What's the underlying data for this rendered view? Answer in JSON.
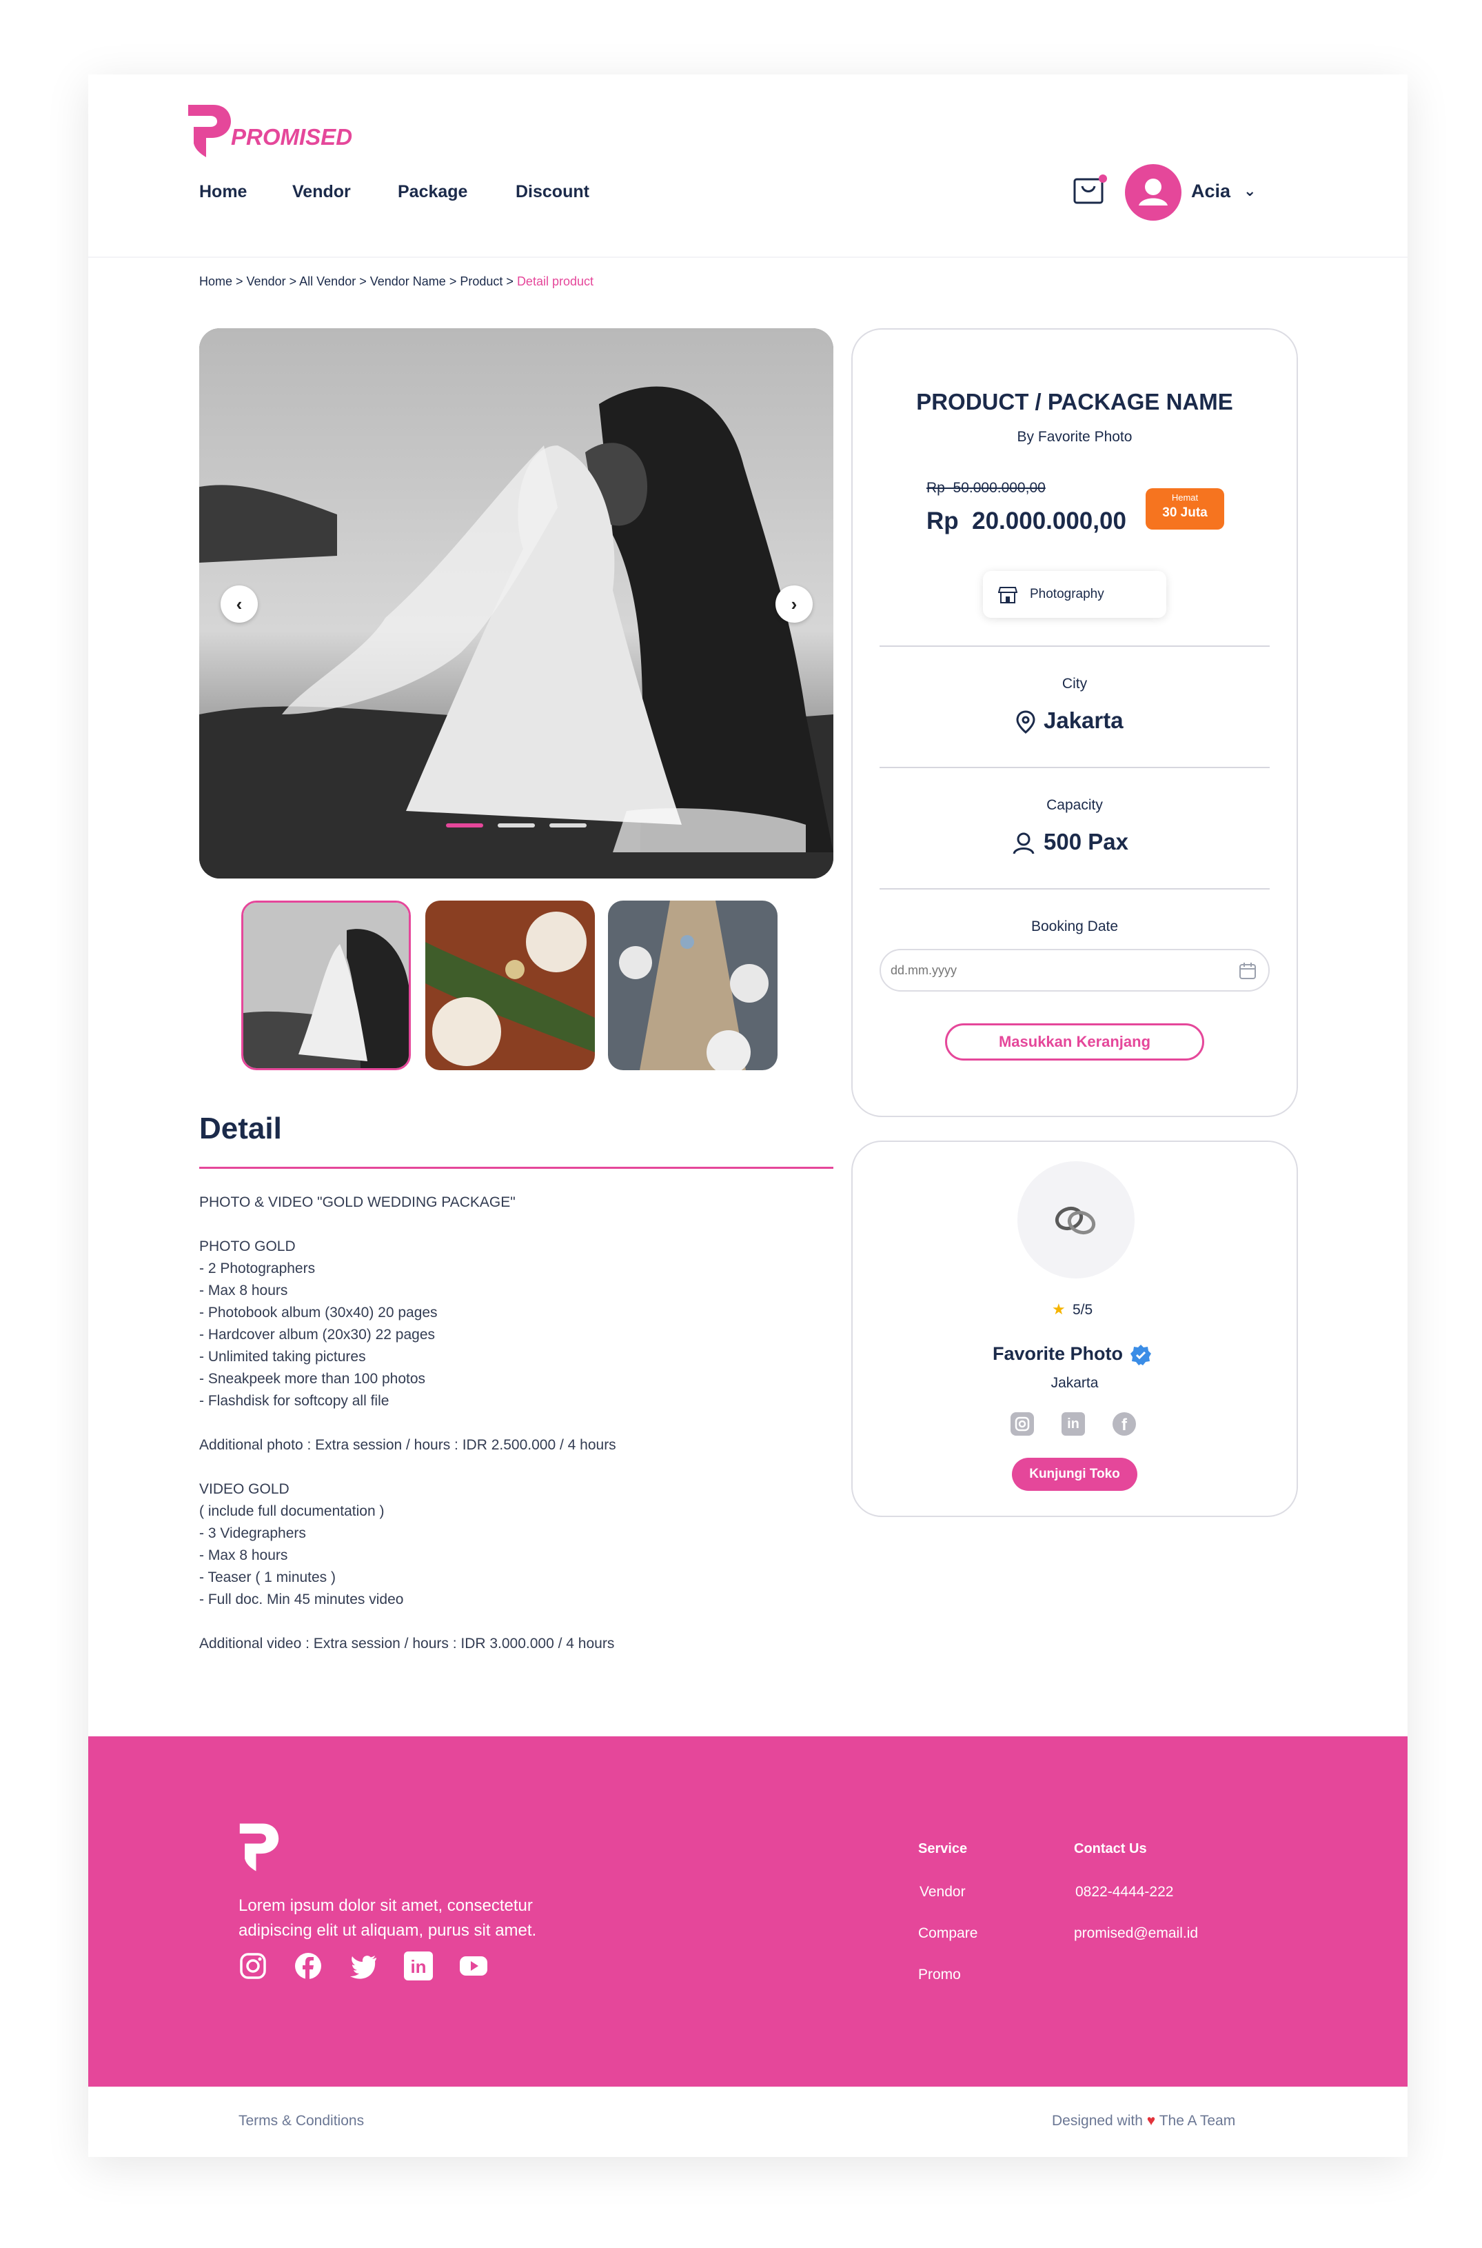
{
  "brand": {
    "name": "PROMISED",
    "accent": "#e5479a",
    "dark": "#1b2a4a"
  },
  "nav": {
    "items": [
      {
        "label": "Home"
      },
      {
        "label": "Vendor"
      },
      {
        "label": "Package"
      },
      {
        "label": "Discount"
      }
    ]
  },
  "user": {
    "name": "Acia"
  },
  "breadcrumb": {
    "items": [
      {
        "label": "Home"
      },
      {
        "label": "Vendor"
      },
      {
        "label": "All Vendor"
      },
      {
        "label": "Vendor Name"
      },
      {
        "label": "Product"
      }
    ],
    "current": "Detail product"
  },
  "gallery": {
    "slide_count": 3,
    "active_slide": 1,
    "thumbnails": [
      "wedding-couple-veil",
      "dinner-table-greenery",
      "long-dining-table"
    ]
  },
  "detail": {
    "title": "Detail",
    "lines": [
      "PHOTO & VIDEO \"GOLD WEDDING PACKAGE\"",
      "",
      "PHOTO GOLD",
      "- 2 Photographers",
      "- Max 8 hours",
      "- Photobook album (30x40) 20 pages",
      "- Hardcover album (20x30) 22 pages",
      "- Unlimited taking pictures",
      "- Sneakpeek more than 100 photos",
      "- Flashdisk for softcopy all file",
      "",
      "Additional photo : Extra session / hours : IDR 2.500.000 / 4 hours",
      "",
      "VIDEO GOLD",
      "( include full documentation )",
      "- 3 Videgraphers",
      "- Max 8 hours",
      "- Teaser ( 1 minutes )",
      "- Full doc. Min 45 minutes video",
      "",
      "Additional video : Extra session / hours : IDR 3.000.000 / 4 hours"
    ]
  },
  "product": {
    "name": "PRODUCT / PACKAGE NAME",
    "by": "By Favorite Photo",
    "old_price": "Rp  50.000.000,00",
    "price": "Rp  20.000.000,00",
    "save_label": "Hemat",
    "save_value": "30 Juta",
    "category": "Photography",
    "city_label": "City",
    "city": "Jakarta",
    "capacity_label": "Capacity",
    "capacity": "500 Pax",
    "booking_label": "Booking Date",
    "date_placeholder": "dd.mm.yyyy",
    "cart_button": "Masukkan Keranjang"
  },
  "vendor": {
    "rating": "5/5",
    "name": "Favorite Photo",
    "city": "Jakarta",
    "socials": [
      "instagram-icon",
      "linkedin-icon",
      "facebook-icon"
    ],
    "visit_button": "Kunjungi Toko"
  },
  "footer": {
    "tagline_1": "Lorem ipsum dolor sit amet, consectetur",
    "tagline_2": "adipiscing elit ut aliquam, purus sit amet.",
    "service": {
      "title": "Service",
      "items": [
        "Vendor",
        "Compare",
        "Promo"
      ]
    },
    "contact": {
      "title": "Contact Us",
      "phone": "0822-4444-222",
      "email": "promised@email.id"
    },
    "socials": [
      "instagram-icon",
      "facebook-icon",
      "twitter-icon",
      "linkedin-icon",
      "youtube-icon"
    ],
    "terms": "Terms & Conditions",
    "credit_prefix": "Designed with",
    "credit_team": "The A Team"
  }
}
